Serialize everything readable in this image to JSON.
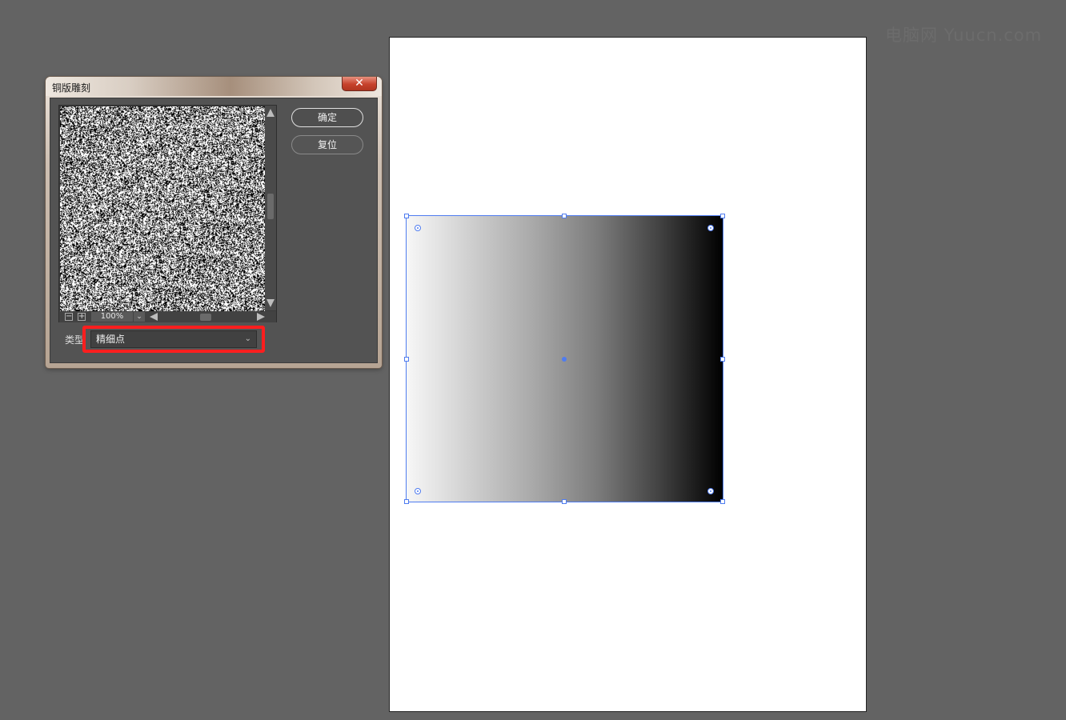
{
  "watermark": "电脑网 Yuucn.com",
  "dialog": {
    "title": "铜版雕刻",
    "close_symbol": "✕",
    "zoom_out_symbol": "−",
    "zoom_in_symbol": "+",
    "zoom_level": "100%",
    "dropdown_symbol": "⌄",
    "ok_label": "确定",
    "reset_label": "复位",
    "type_label": "类型",
    "type_value": "精细点"
  },
  "colors": {
    "workspace": "#636363",
    "selection": "#4f7cf0",
    "highlight": "#ff1e1e"
  }
}
